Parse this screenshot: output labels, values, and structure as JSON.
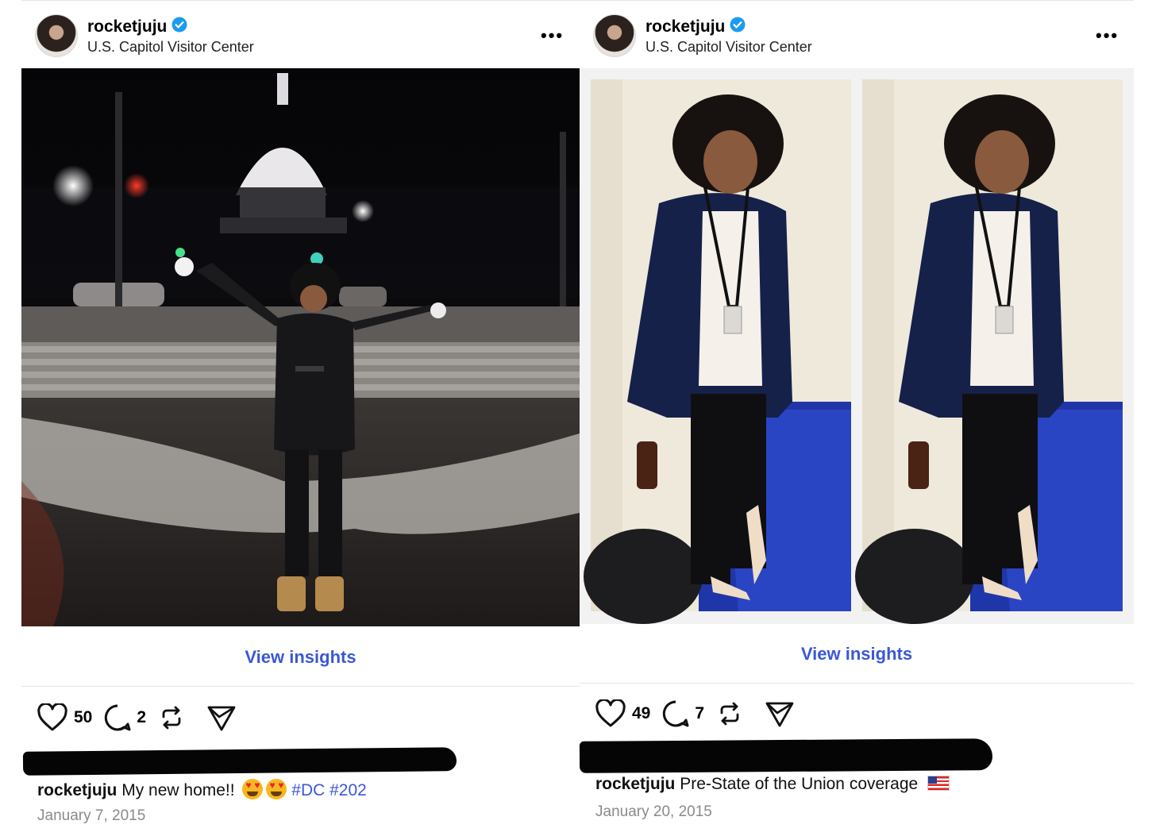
{
  "posts": [
    {
      "username": "rocketjuju",
      "location": "U.S. Capitol Visitor Center",
      "more_label": "•••",
      "insights_label": "View insights",
      "likes": "50",
      "comments": "2",
      "caption_user": "rocketjuju",
      "caption_text": "My new home!!",
      "caption_emojis": [
        "heart-eyes-emoji",
        "heart-eyes-emoji"
      ],
      "hashtags": "#DC #202",
      "date": "January 7, 2015"
    },
    {
      "username": "rocketjuju",
      "location": "U.S. Capitol Visitor Center",
      "more_label": "•••",
      "insights_label": "View insights",
      "likes": "49",
      "comments": "7",
      "caption_user": "rocketjuju",
      "caption_text": "Pre-State of the Union coverage",
      "caption_emojis": [
        "us-flag-emoji"
      ],
      "date": "January 20, 2015"
    }
  ],
  "icons": [
    "verified-badge-icon",
    "more-icon",
    "heart-icon",
    "comment-icon",
    "repost-icon",
    "share-icon"
  ],
  "colors": {
    "link": "#3b57d6",
    "verified": "#1d9bf0",
    "date": "#8a8a8a",
    "divider": "#e6e6e6"
  }
}
